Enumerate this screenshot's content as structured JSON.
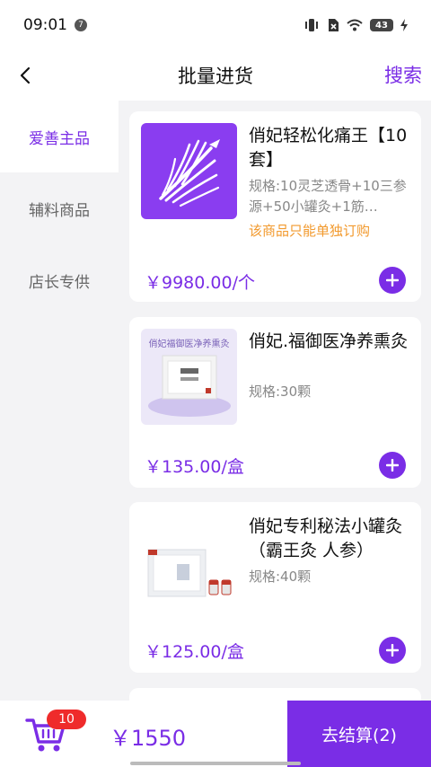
{
  "status_bar": {
    "time": "09:01",
    "notification_badge": "7",
    "battery_level": "43"
  },
  "header": {
    "title": "批量进货",
    "search_label": "搜索"
  },
  "sidebar": {
    "items": [
      {
        "label": "爱善主品",
        "active": true
      },
      {
        "label": "辅料商品",
        "active": false
      },
      {
        "label": "店长专供",
        "active": false
      }
    ]
  },
  "products": [
    {
      "name": "俏妃轻松化痛王【10套】",
      "spec": "规格:10灵芝透骨+10三参源+50小罐灸+1筋…",
      "note": "该商品只能单独订购",
      "price": "￥9980.00/个"
    },
    {
      "name": "俏妃.福御医净养熏灸",
      "spec": "规格:30颗",
      "note": "",
      "price": "￥135.00/盒",
      "thumb_text": "俏妃福御医净养熏灸"
    },
    {
      "name": "俏妃专利秘法小罐灸（霸王灸 人参）",
      "spec": "规格:40颗",
      "note": "",
      "price": "￥125.00/盒"
    }
  ],
  "bottom_bar": {
    "cart_count": "10",
    "total": "￥1550",
    "checkout_label": "去结算(2)"
  },
  "colors": {
    "accent": "#7a2de6",
    "badge_red": "#ef2b2b",
    "note_orange": "#f29a2e"
  }
}
